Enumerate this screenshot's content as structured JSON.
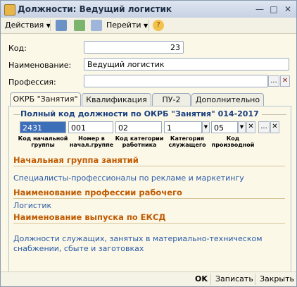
{
  "window": {
    "title": "Должности: Ведущий логистик"
  },
  "toolbar": {
    "actions_label": "Действия",
    "goto_label": "Перейти"
  },
  "form": {
    "code_label": "Код:",
    "code_value": "23",
    "name_label": "Наименование:",
    "name_value": "Ведущий логистик",
    "profession_label": "Профессия:",
    "profession_value": ""
  },
  "tabs": [
    "ОКРБ \"Занятия\"",
    "Квалификация",
    "ПУ-2",
    "Дополнительно"
  ],
  "okrb": {
    "group_title": "Полный код должности по ОКРБ \"Занятия\" 014-2017",
    "codes": [
      "2431",
      "001",
      "02",
      "1",
      "05"
    ],
    "captions": [
      "Код начальной группы",
      "Номер в начал.группе",
      "Код категории работника",
      "Категория служащего",
      "Код производной"
    ]
  },
  "sections": {
    "initial_group_title": "Начальная группа занятий",
    "initial_group_value": "Специалисты-профессионалы по рекламе и маркетингу",
    "worker_profession_title": "Наименование профессии рабочего",
    "worker_profession_value": "Логистик",
    "eksd_title": "Наименование выпуска по ЕКСД",
    "eksd_value": "Должности служащих, занятых в материально-техническом снабжении, сбыте и заготовках"
  },
  "bottom": {
    "ok_label": "OK",
    "save_label": "Записать",
    "close_label": "Закрыть"
  },
  "colors": {
    "accent_orange": "#c05a00",
    "link_blue": "#2a5aa6",
    "group_blue": "#1b3f7f"
  }
}
